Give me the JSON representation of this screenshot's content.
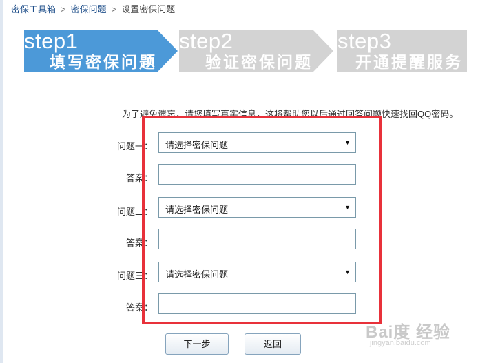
{
  "breadcrumb": {
    "items": [
      "密保工具箱",
      "密保问题",
      "设置密保问题"
    ],
    "separator": ">"
  },
  "steps": [
    {
      "word": "step1",
      "title": "填写密保问题",
      "state": "active",
      "color": "#4c99d8"
    },
    {
      "word": "step2",
      "title": "验证密保问题",
      "state": "inactive",
      "color": "#d3d3d3"
    },
    {
      "word": "step3",
      "title": "开通提醒服务",
      "state": "inactive",
      "color": "#d3d3d3"
    }
  ],
  "instruction": "为了避免遗忘，请您填写真实信息，这将帮助您以后通过回答问题快速找回QQ密码。",
  "form": {
    "q1_label": "问题一：",
    "q1_value": "请选择密保问题",
    "a1_label": "答案：",
    "a1_value": "",
    "q2_label": "问题二：",
    "q2_value": "请选择密保问题",
    "a2_label": "答案：",
    "a2_value": "",
    "q3_label": "问题三：",
    "q3_value": "请选择密保问题",
    "a3_label": "答案：",
    "a3_value": ""
  },
  "buttons": {
    "next": "下一步",
    "back": "返回"
  },
  "watermark": {
    "brand": "Bai度 经验",
    "url": "jingyan.baidu.com"
  },
  "colors": {
    "active_step": "#4c99d8",
    "inactive_step": "#d3d3d3",
    "highlight_border": "#e8313a",
    "link": "#1f4f8a"
  }
}
